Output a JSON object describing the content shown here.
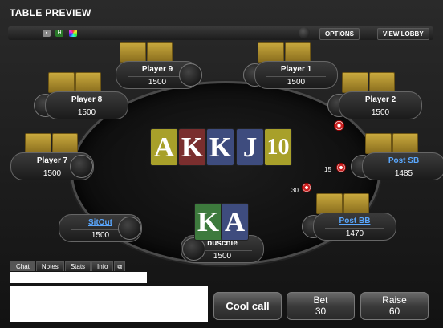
{
  "window": {
    "title": "TABLE PREVIEW"
  },
  "toolbar": {
    "icons": [
      "camera-icon",
      "hand-history-icon",
      "color-wheel-icon"
    ],
    "hh_label": "H",
    "options_label": "OPTIONS",
    "view_lobby_label": "VIEW LOBBY"
  },
  "players": {
    "p9": {
      "name": "Player 9",
      "stack": "1500"
    },
    "p1": {
      "name": "Player 1",
      "stack": "1500"
    },
    "p8": {
      "name": "Player 8",
      "stack": "1500"
    },
    "p2": {
      "name": "Player 2",
      "stack": "1500"
    },
    "p7": {
      "name": "Player 7",
      "stack": "1500"
    },
    "sb": {
      "name": "Post SB",
      "stack": "1485"
    },
    "sitout": {
      "name": "SitOut",
      "stack": "1500"
    },
    "bb": {
      "name": "Post BB",
      "stack": "1470"
    },
    "hero": {
      "name": "buschle",
      "stack": "1500"
    }
  },
  "board": [
    {
      "rank": "A",
      "color": "#a8a02a"
    },
    {
      "rank": "K",
      "color": "#7a2e2e"
    },
    {
      "rank": "K",
      "color": "#3e4c7e"
    },
    {
      "rank": "J",
      "color": "#3e4c7e"
    },
    {
      "rank": "10",
      "color": "#a8a02a"
    }
  ],
  "hero_cards": [
    {
      "rank": "K",
      "color": "#3d7a3d"
    },
    {
      "rank": "A",
      "color": "#3e4c7e"
    }
  ],
  "bets": {
    "sb": "15",
    "bb": "30"
  },
  "chat_tabs": [
    "Chat",
    "Notes",
    "Stats",
    "Info"
  ],
  "actions": {
    "cool_call": "Cool call",
    "bet_label": "Bet",
    "bet_amount": "30",
    "raise_label": "Raise",
    "raise_amount": "60"
  }
}
